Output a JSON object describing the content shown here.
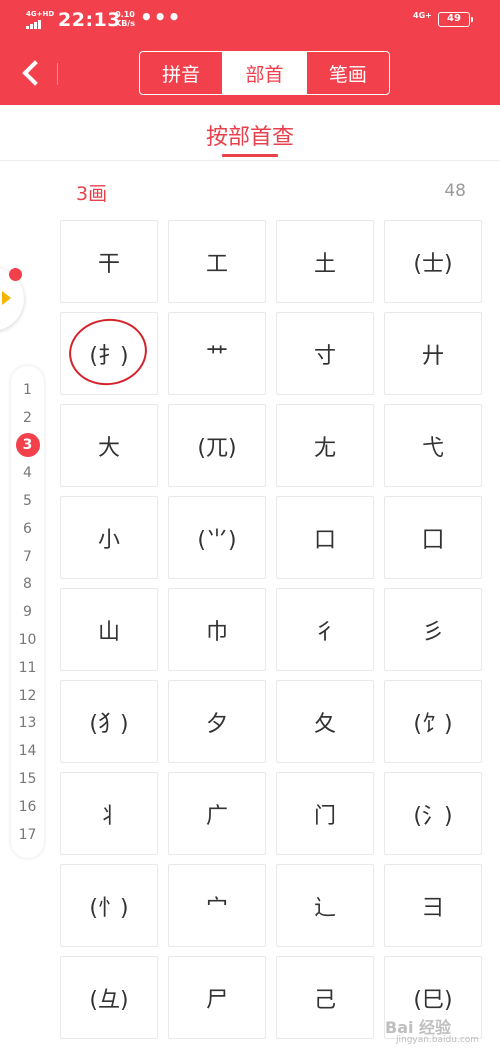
{
  "status_bar": {
    "network_left": "4G+HD",
    "time": "22:13",
    "speed_value": "0.10",
    "speed_unit": "KB/s",
    "more": "•••",
    "network_right": "4G+",
    "battery": "49"
  },
  "nav": {
    "tabs": [
      {
        "label": "拼音",
        "active": false
      },
      {
        "label": "部首",
        "active": true
      },
      {
        "label": "笔画",
        "active": false
      }
    ]
  },
  "subtitle": "按部首查",
  "section": {
    "title": "3画",
    "count": "48"
  },
  "radicals": [
    "干",
    "工",
    "土",
    "(士)",
    "(扌)",
    "艹",
    "寸",
    "廾",
    "大",
    "(兀)",
    "尢",
    "弋",
    "小",
    "(⺌)",
    "口",
    "囗",
    "山",
    "巾",
    "彳",
    "彡",
    "(犭)",
    "夕",
    "夂",
    "(饣)",
    "丬",
    "广",
    "门",
    "(氵)",
    "(忄)",
    "宀",
    "辶",
    "彐",
    "(彑)",
    "尸",
    "己",
    "(巳)"
  ],
  "index": {
    "items": [
      "1",
      "2",
      "3",
      "4",
      "5",
      "6",
      "7",
      "8",
      "9",
      "10",
      "11",
      "12",
      "13",
      "14",
      "15",
      "16",
      "17"
    ],
    "active": "3"
  },
  "watermark": {
    "text": "Bai 经验",
    "url": "jingyan.baidu.com"
  },
  "colors": {
    "brand": "#f2404c",
    "highlight_ring": "#d4242b",
    "accent_yellow": "#f5b400"
  }
}
